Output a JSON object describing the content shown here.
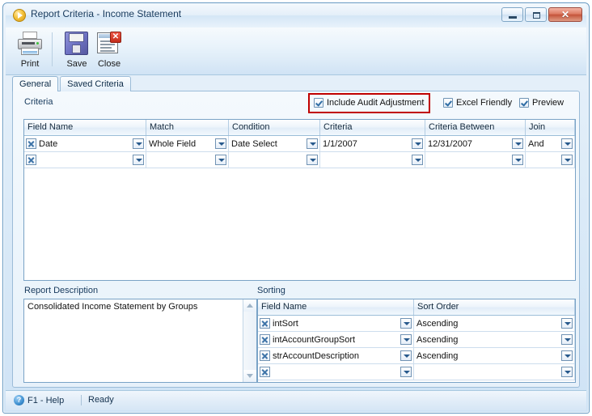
{
  "window": {
    "title": "Report Criteria - Income Statement",
    "title_icon": "play-circle-icon",
    "buttons": {
      "minimize": "minimize-icon",
      "maximize": "maximize-icon",
      "close": "✕"
    }
  },
  "toolbar": {
    "items": [
      {
        "label": "Print",
        "icon": "printer-icon"
      },
      {
        "label": "Save",
        "icon": "floppy-disk-icon"
      },
      {
        "label": "Close",
        "icon": "document-close-icon"
      }
    ]
  },
  "tabs": [
    {
      "label": "General",
      "active": true
    },
    {
      "label": "Saved Criteria",
      "active": false
    }
  ],
  "criteria_section": {
    "label": "Criteria",
    "options": [
      {
        "label": "Include Audit Adjustment",
        "checked": true,
        "highlighted": true
      },
      {
        "label": "Excel Friendly",
        "checked": true,
        "highlighted": false
      },
      {
        "label": "Preview",
        "checked": true,
        "highlighted": false
      }
    ],
    "columns": [
      "Field Name",
      "Match",
      "Condition",
      "Criteria",
      "Criteria Between",
      "Join"
    ],
    "rows": [
      {
        "field_name": "Date",
        "match": "Whole Field",
        "condition": "Date Select",
        "criteria": "1/1/2007",
        "criteria_between": "12/31/2007",
        "join": "And"
      },
      {
        "field_name": "",
        "match": "",
        "condition": "",
        "criteria": "",
        "criteria_between": "",
        "join": ""
      }
    ]
  },
  "report_description": {
    "label": "Report Description",
    "text": "Consolidated Income Statement by Groups"
  },
  "sorting": {
    "label": "Sorting",
    "columns": [
      "Field Name",
      "Sort Order"
    ],
    "rows": [
      {
        "field_name": "intSort",
        "sort_order": "Ascending"
      },
      {
        "field_name": "intAccountGroupSort",
        "sort_order": "Ascending"
      },
      {
        "field_name": "strAccountDescription",
        "sort_order": "Ascending"
      },
      {
        "field_name": "",
        "sort_order": ""
      }
    ]
  },
  "statusbar": {
    "help_icon": "?",
    "help_label": "F1 - Help",
    "status": "Ready"
  },
  "colors": {
    "highlight": "#c00000",
    "title_text": "#16395c",
    "frame_border": "#6a9bc3"
  }
}
